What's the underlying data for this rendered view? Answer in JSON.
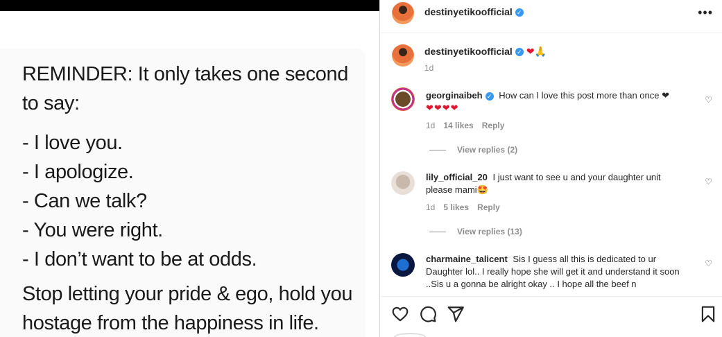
{
  "post": {
    "lines1": [
      "REMINDER: It only takes one second",
      "to say:"
    ],
    "list": [
      "- I love you.",
      "- I apologize.",
      "- Can we talk?",
      "- You were right.",
      "- I don’t want to be at odds."
    ],
    "lines2": [
      "Stop letting your pride & ego, hold you",
      "hostage from the happiness in life."
    ]
  },
  "header": {
    "username": "destinyetikoofficial",
    "verified_glyph": "✓",
    "more_glyph": "•••"
  },
  "caption": {
    "username": "destinyetikoofficial",
    "emoji": "❤🙏",
    "time": "1d"
  },
  "comments": [
    {
      "username": "georginaibeh",
      "verified": true,
      "text": "How can I love this post more than once ❤",
      "text2": "❤❤❤❤",
      "time": "1d",
      "likes": "14 likes",
      "reply": "Reply",
      "view_replies": "View replies (2)"
    },
    {
      "username": "lily_official_20",
      "verified": false,
      "text": "I just want to see u and your daughter unit please mami🤩",
      "time": "1d",
      "likes": "5 likes",
      "reply": "Reply",
      "view_replies": "View replies (13)"
    },
    {
      "username": "charmaine_talicent",
      "verified": false,
      "text": "Sis I guess all this is dedicated to ur Daughter lol.. I really hope she will get it and understand it soon ..Sis u a gonna be alright okay .. I hope all the beef n"
    }
  ],
  "icons": {
    "heart": "heart-icon",
    "comment": "comment-icon",
    "share": "share-icon",
    "save": "bookmark-icon",
    "like_small": "small-heart-icon"
  },
  "colors": {
    "verified": "#3897f0",
    "heart": "#e0152e",
    "muted": "#8e8e8e"
  }
}
